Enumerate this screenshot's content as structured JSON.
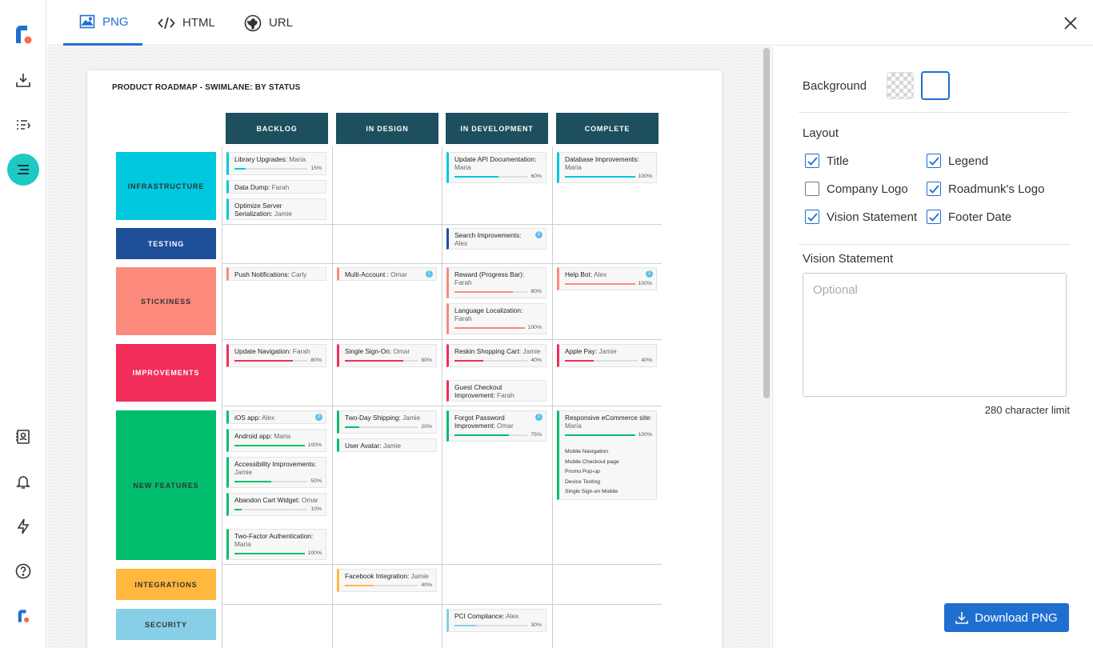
{
  "tabs": [
    {
      "label": "PNG",
      "icon": "image-icon"
    },
    {
      "label": "HTML",
      "icon": "code-icon"
    },
    {
      "label": "URL",
      "icon": "globe-icon"
    }
  ],
  "sidebar": {
    "icons": [
      "roadmunk-logo",
      "download-icon",
      "list-icon",
      "roadmap-icon",
      "contacts-icon",
      "bell-icon",
      "lightning-icon",
      "help-icon",
      "roadmunk-logo-small"
    ]
  },
  "roadmap": {
    "title": "PRODUCT ROADMAP - SWIMLANE: BY STATUS",
    "columns": [
      "BACKLOG",
      "IN DESIGN",
      "IN DEVELOPMENT",
      "COMPLETE"
    ],
    "lanes": [
      {
        "name": "INFRASTRUCTURE",
        "color": "#00c8de"
      },
      {
        "name": "TESTING",
        "color": "#1e4f99"
      },
      {
        "name": "STICKINESS",
        "color": "#fb8a7c"
      },
      {
        "name": "IMPROVEMENTS",
        "color": "#f22d5a"
      },
      {
        "name": "NEW FEATURES",
        "color": "#00be6d"
      },
      {
        "name": "INTEGRATIONS",
        "color": "#ffb83d"
      },
      {
        "name": "SECURITY",
        "color": "#86cfe6"
      }
    ],
    "cards": [
      {
        "title": "Library Upgrades:",
        "owner": "Maria",
        "progress": 15,
        "lane": 0,
        "col": 0
      },
      {
        "title": "Data Dump:",
        "owner": "Farah",
        "lane": 0,
        "col": 0
      },
      {
        "title": "Optimize Server Serialization:",
        "owner": "Jamie",
        "lane": 0,
        "col": 0
      },
      {
        "title": "Update API Documentation:",
        "owner": "Maria",
        "progress": 60,
        "lane": 0,
        "col": 2
      },
      {
        "title": "Database Improvements:",
        "owner": "Maria",
        "progress": 100,
        "lane": 0,
        "col": 3
      },
      {
        "title": "Search Improvements:",
        "owner": "Alex",
        "badge": "1",
        "lane": 1,
        "col": 2
      },
      {
        "title": "Push Notifications:",
        "owner": "Carly",
        "lane": 2,
        "col": 0
      },
      {
        "title": "Multi-Account :",
        "owner": "Omar",
        "badge": "1",
        "lane": 2,
        "col": 1
      },
      {
        "title": "Reward (Progress Bar):",
        "owner": "Farah",
        "progress": 80,
        "lane": 2,
        "col": 2
      },
      {
        "title": "Language Localization:",
        "owner": "Farah",
        "progress": 100,
        "lane": 2,
        "col": 2
      },
      {
        "title": "Help Bot:",
        "owner": "Alex",
        "badge": "1",
        "progress": 100,
        "lane": 2,
        "col": 3
      },
      {
        "title": "Update Navigation:",
        "owner": "Farah",
        "progress": 80,
        "lane": 3,
        "col": 0
      },
      {
        "title": "Single Sign-On:",
        "owner": "Omar",
        "progress": 80,
        "lane": 3,
        "col": 1
      },
      {
        "title": "Reskin Shopping Cart:",
        "owner": "Jamie",
        "progress": 40,
        "lane": 3,
        "col": 2
      },
      {
        "title": "Guest Checkout Improvement:",
        "owner": "Farah",
        "lane": 3,
        "col": 2
      },
      {
        "title": "Apple Pay:",
        "owner": "Jamie",
        "progress": 40,
        "lane": 3,
        "col": 3
      },
      {
        "title": "iOS app:",
        "owner": "Alex",
        "badge": "2",
        "lane": 4,
        "col": 0
      },
      {
        "title": "Android app:",
        "owner": "Maria",
        "progress": 100,
        "lane": 4,
        "col": 0
      },
      {
        "title": "Accessibility Improvements:",
        "owner": "Jamie",
        "progress": 50,
        "lane": 4,
        "col": 0
      },
      {
        "title": "Abandon Cart Widget:",
        "owner": "Omar",
        "progress": 10,
        "lane": 4,
        "col": 0
      },
      {
        "title": "Two-Factor Authentication:",
        "owner": "Maria",
        "progress": 100,
        "lane": 4,
        "col": 0
      },
      {
        "title": "Two-Day Shipping:",
        "owner": "Jamie",
        "progress": 20,
        "lane": 4,
        "col": 1
      },
      {
        "title": "User Avatar:",
        "owner": "Jamie",
        "lane": 4,
        "col": 1
      },
      {
        "title": "Forgot Password Improvement:",
        "owner": "Omar",
        "badge": "1",
        "progress": 75,
        "lane": 4,
        "col": 2
      },
      {
        "title": "Responsive eCommerce site:",
        "owner": "Maria",
        "progress": 100,
        "lane": 4,
        "col": 3,
        "subitems": [
          "Mobile Navigation",
          "Mobile Checkout page",
          "Promo Pop-up",
          "Device Testing",
          "Single Sign-on Mobile"
        ]
      },
      {
        "title": "Facebook Integration:",
        "owner": "Jamie",
        "progress": 40,
        "lane": 5,
        "col": 1
      },
      {
        "title": "PCI Compliance:",
        "owner": "Alex",
        "progress": 30,
        "lane": 6,
        "col": 2
      }
    ]
  },
  "panel": {
    "background_label": "Background",
    "layout_label": "Layout",
    "options": [
      {
        "label": "Title",
        "checked": true
      },
      {
        "label": "Legend",
        "checked": true
      },
      {
        "label": "Company Logo",
        "checked": false
      },
      {
        "label": "Roadmunk's Logo",
        "checked": true
      },
      {
        "label": "Vision Statement",
        "checked": true
      },
      {
        "label": "Footer Date",
        "checked": true
      }
    ],
    "vision_label": "Vision Statement",
    "vision_placeholder": "Optional",
    "char_limit": "280 character limit",
    "download_label": "Download PNG"
  },
  "colors": {
    "accent": "#1f6fd1",
    "header": "#1d4f5e",
    "sidebar_active": "#1fc9c3"
  }
}
